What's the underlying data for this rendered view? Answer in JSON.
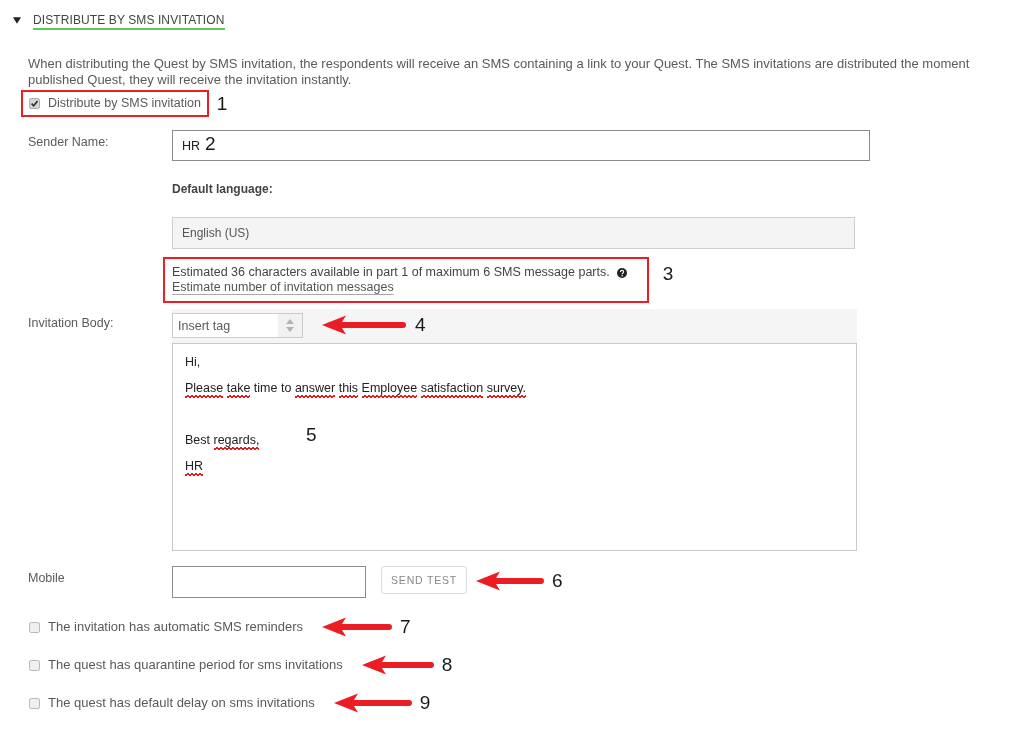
{
  "section": {
    "title": "DISTRIBUTE BY SMS INVITATION",
    "expanded": true
  },
  "description": [
    "When distributing the Quest by SMS invitation, the respondents will receive an SMS containing a link to your Quest. The SMS invitations are distributed the moment",
    "published Quest, they will receive the invitation instantly."
  ],
  "sms_checkbox": {
    "label": "Distribute by SMS invitation",
    "checked": true,
    "marker": {
      "kind": "box",
      "number": "1"
    }
  },
  "sender_name": {
    "label": "Sender Name:",
    "value": "HR",
    "marker": {
      "kind": "plain",
      "number": "2"
    }
  },
  "default_language": {
    "label": "Default language:",
    "value": "English (US)"
  },
  "estimate": {
    "text": "Estimated 36 characters available in part 1 of maximum 6 SMS message parts.",
    "link": "Estimate number of invitation messages",
    "marker": {
      "kind": "box",
      "number": "3"
    }
  },
  "invitation_body": {
    "label": "Invitation Body:",
    "insert_tag": {
      "label": "Insert tag",
      "marker": {
        "kind": "arrow",
        "number": "4"
      }
    },
    "marker": {
      "kind": "plain",
      "number": "5"
    },
    "paragraphs": [
      {
        "lines": [
          {
            "words": [
              {
                "text": "Hi,",
                "flagged": false
              }
            ]
          },
          {
            "words": [
              {
                "text": "Please",
                "flagged": true
              },
              {
                "text": "take",
                "flagged": true
              },
              {
                "text": "time",
                "flagged": false
              },
              {
                "text": "to",
                "flagged": false
              },
              {
                "text": "answer",
                "flagged": true
              },
              {
                "text": "this",
                "flagged": true
              },
              {
                "text": "Employee",
                "flagged": true
              },
              {
                "text": "satisfaction",
                "flagged": true
              },
              {
                "text": "survey.",
                "flagged": true
              }
            ]
          }
        ]
      },
      {
        "lines": [
          {
            "words": [
              {
                "text": "Best",
                "flagged": false
              },
              {
                "text": "regards,",
                "flagged": true
              }
            ]
          },
          {
            "words": [
              {
                "text": "HR",
                "flagged": true
              }
            ]
          }
        ]
      }
    ]
  },
  "mobile": {
    "label": "Mobile",
    "button": "SEND TEST",
    "marker": {
      "kind": "arrow",
      "number": "6"
    }
  },
  "options": [
    {
      "label": "The invitation has automatic SMS reminders",
      "checked": false,
      "marker": {
        "kind": "arrow",
        "number": "7"
      }
    },
    {
      "label": "The quest has quarantine period for sms invitations",
      "checked": false,
      "marker": {
        "kind": "arrow",
        "number": "8"
      }
    },
    {
      "label": "The quest has default delay on sms invitations",
      "checked": false,
      "marker": {
        "kind": "arrow",
        "number": "9"
      }
    }
  ]
}
